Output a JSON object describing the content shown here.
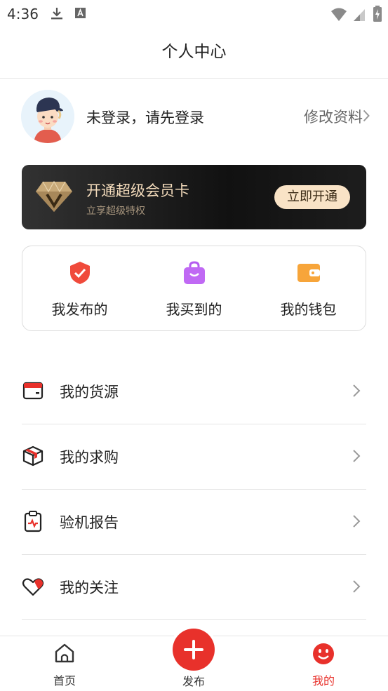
{
  "status_bar": {
    "time": "4:36",
    "left_icons": [
      "download-icon",
      "a-letter-icon"
    ],
    "right_icons": [
      "wifi-icon",
      "signal-icon",
      "battery-charging-icon"
    ]
  },
  "header": {
    "title": "个人中心"
  },
  "profile": {
    "login_prompt": "未登录，请先登录",
    "edit_label": "修改资料"
  },
  "vip_card": {
    "title": "开通超级会员卡",
    "subtitle": "立享超级特权",
    "button": "立即开通",
    "icon": "diamond-v-icon"
  },
  "shortcuts": [
    {
      "label": "我发布的",
      "icon": "shield-check-icon",
      "color": "#f04a3b"
    },
    {
      "label": "我买到的",
      "icon": "shopping-bag-icon",
      "color": "#b45cf0"
    },
    {
      "label": "我的钱包",
      "icon": "wallet-icon",
      "color": "#f7a53a"
    }
  ],
  "menu": [
    {
      "label": "我的货源",
      "icon": "goods-card-icon"
    },
    {
      "label": "我的求购",
      "icon": "package-box-icon"
    },
    {
      "label": "验机报告",
      "icon": "clipboard-report-icon"
    },
    {
      "label": "我的关注",
      "icon": "heart-icon"
    }
  ],
  "tab_bar": {
    "items": [
      {
        "label": "首页",
        "icon": "home-icon"
      },
      {
        "label": "发布",
        "icon": "plus-icon"
      },
      {
        "label": "我的",
        "icon": "smile-face-icon"
      }
    ],
    "active": "我的",
    "active_color": "#e8312b"
  }
}
